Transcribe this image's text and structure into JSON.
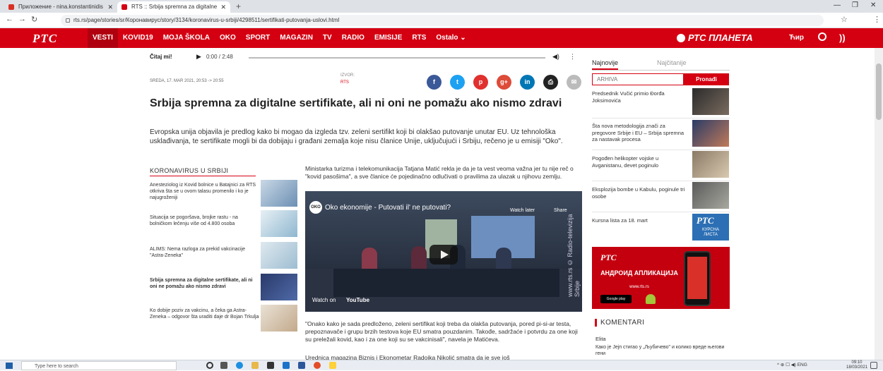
{
  "browser": {
    "tabs": [
      {
        "label": "Приложение - nina.konstantinidis",
        "active": false
      },
      {
        "label": "RTS :: Srbija spremna za digitalne",
        "active": true
      }
    ],
    "url": "rts.rs/page/stories/sr/Коронавирус/story/3134/koronavirus-u-srbiji/4298511/sertifikati-putovanja-uslovi.html"
  },
  "site": {
    "logo": "РТС",
    "menu": [
      "VESTI",
      "KOVID19",
      "MOJA ŠKOLA",
      "OKO",
      "SPORT",
      "MAGAZIN",
      "TV",
      "RADIO",
      "EMISIJE",
      "RTS",
      "Ostalo ⌄"
    ],
    "planeta_brand": "РТС ПЛАНЕТА",
    "script_switch": "Ћир",
    "accent": "#d40012"
  },
  "player": {
    "label": "Čitaj mi!",
    "time": "0:00 / 2:48"
  },
  "article": {
    "date": "SREDA, 17. MAR 2021, 20:53 -> 20:55",
    "source_label": "IZVOR:",
    "source_value": "RTS",
    "title": "Srbija spremna za digitalne sertifikate, ali ni oni ne pomažu ako nismo zdravi",
    "lead": "Evropska unija objavila je predlog kako bi mogao da izgleda tzv. zeleni sertifikt koji bi olakšao putovanje unutar EU. Uz tehnološka usklađivanja, te sertifikate mogli bi da dobijaju i građani zemalja koje nisu članice Unije, uključujući i Srbiju, rečeno je u emisiji \"Oko\".",
    "p1": "Ministarka turizma i telekomunikacija Tatjana Matić rekla je da je ta vest veoma važna jer tu nije reč o \"kovid pasošima\", a sve članice će pojedinačno odlučivati o pravilima za ulazak u njihovu zemlju.",
    "p2": "\"Onako kako je sada predloženo, zeleni sertifikat koji treba da olakša putovanja, pored pi-si-ar testa, prepoznavače i grupu brzih testova koje EU smatra pouzdanim. Takođe, sadržaće i potvrdu za one koji su preležali kovid, kao i za one koji su se vakcinisali\", navela je Matićeva.",
    "p3": "Urednica magazina Biznis i Ekonometar Radojka Nikolić smatra da je sve još"
  },
  "video": {
    "title": "Oko ekonomije - Putovati il' ne putovati?",
    "channel": "OKO",
    "watch_later": "Watch later",
    "share": "Share",
    "watch_on": "Watch on",
    "youtube": "YouTube",
    "watermark": "www.rts.rs  © Radio-televizija Srbije"
  },
  "related": {
    "heading": "KORONAVIRUS U SRBIJI",
    "items": [
      "Anesteziolog iz Kovid bolnice u Batajnici za RTS otkriva šta se u ovom talasu promenilo i ko je najugroženiji",
      "Situacija se pogoršava, brojke rastu - na bolničkom lečenju više od 4.800 osoba",
      "ALIMS: Nema razloga za prekid vakcinacije \"Astra-Zeneka\"",
      "Srbija spremna za digitalne sertifikate, ali ni oni ne pomažu ako nismo zdravi",
      "Ko dobije poziv za vakcinu, a čeka ga Astra-Zeneka – odgovor šta uraditi daje dr Bojan Trkulja"
    ]
  },
  "sidebar": {
    "tab_latest": "Najnovije",
    "tab_most_read": "Najčitanije",
    "archive_placeholder": "ARHIVA",
    "archive_button": "Pronađi",
    "news": [
      "Predsednik Vučić primio Đorđa Joksimovića",
      "Šta nova metodologija znači za pregovore Srbije i EU – Srbija spremna za nastavak procesa",
      "Pogođen helikopter vojske u Avganistanu, devet poginulo",
      "Eksplozija bombe u Kabulu, poginule tri osobe",
      "Kursna lista za 18. mart"
    ],
    "kursna_badge": "КУРСНА ЛИСТА",
    "ad": {
      "logo": "РТС",
      "text": "АНДРОИД АПЛИКАЦИЈА",
      "url": "www.rts.rs",
      "store": "Google play"
    },
    "comments_heading": "KOMENTARI",
    "comment_author": "Elita",
    "comment_text": "Како је Јејп стигао у „Љубичево\" и колико вреде његови гени"
  },
  "taskbar": {
    "search_placeholder": "Type here to search",
    "tray": "ENG",
    "time": "09:10",
    "date": "18/03/2021"
  }
}
